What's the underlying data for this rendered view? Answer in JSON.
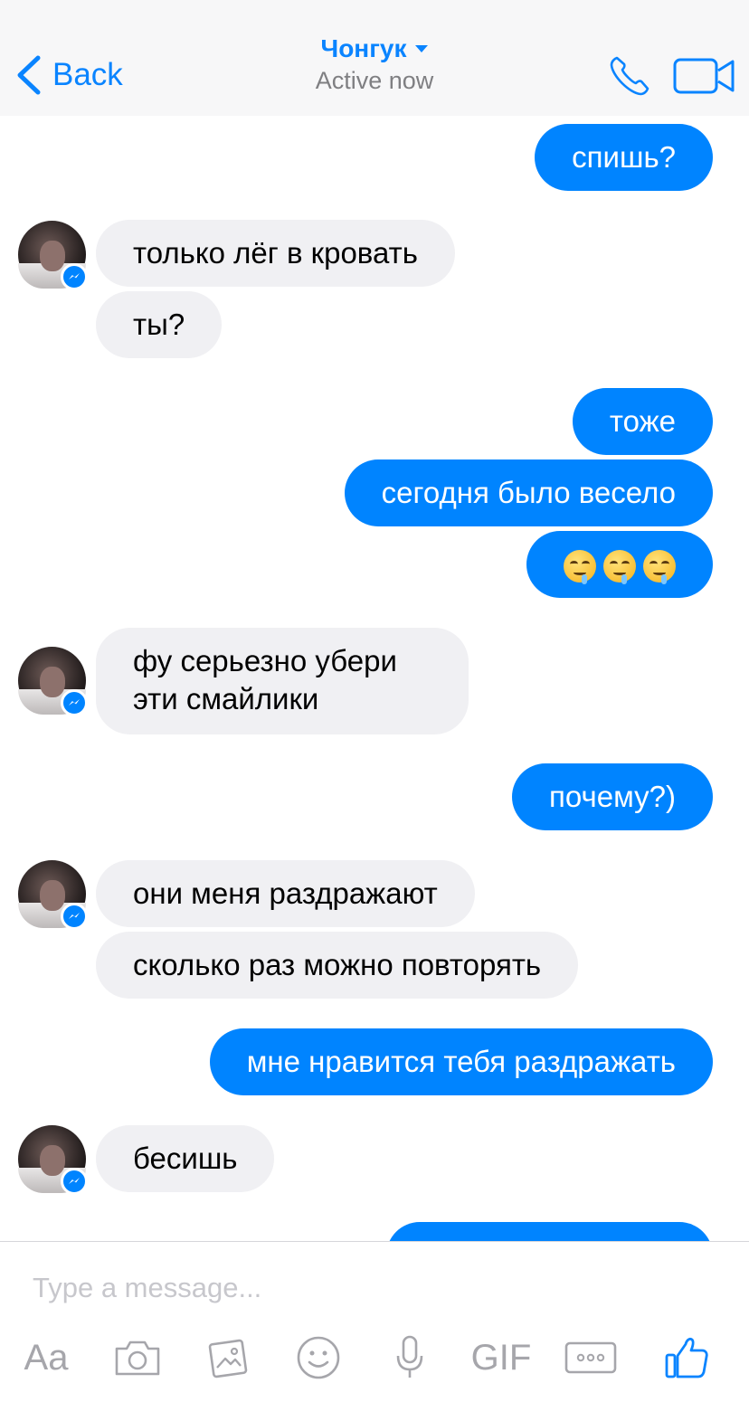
{
  "header": {
    "back_label": "Back",
    "contact_name": "Чонгук",
    "status": "Active now"
  },
  "colors": {
    "accent": "#0a84ff",
    "outgoing_bubble": "#0084ff",
    "incoming_bubble": "#f0f0f3",
    "icon_gray": "#a6a6ab"
  },
  "messages": [
    {
      "direction": "outgoing",
      "text": "спишь?"
    },
    {
      "direction": "incoming",
      "text": "только лёг в кровать"
    },
    {
      "direction": "incoming",
      "text": "ты?"
    },
    {
      "direction": "outgoing",
      "text": "тоже"
    },
    {
      "direction": "outgoing",
      "text": "сегодня было весело"
    },
    {
      "direction": "outgoing",
      "emoji": [
        "drooling-face",
        "drooling-face",
        "drooling-face"
      ]
    },
    {
      "direction": "incoming",
      "text_line1": "фу серьезно убери",
      "text_line2": "эти смайлики"
    },
    {
      "direction": "outgoing",
      "text": "почему?)"
    },
    {
      "direction": "incoming",
      "text": "они меня раздражают"
    },
    {
      "direction": "incoming",
      "text": "сколько раз можно повторять"
    },
    {
      "direction": "outgoing",
      "text": "мне нравится тебя раздражать"
    },
    {
      "direction": "incoming",
      "text": "бесишь"
    }
  ],
  "composer": {
    "placeholder": "Type a message...",
    "tools": {
      "text_label": "Aa",
      "camera": "camera-icon",
      "photos": "photo-icon",
      "emoji": "smiley-icon",
      "voice": "microphone-icon",
      "gif_label": "GIF",
      "more": "more-icon",
      "like": "thumbs-up-icon"
    }
  }
}
